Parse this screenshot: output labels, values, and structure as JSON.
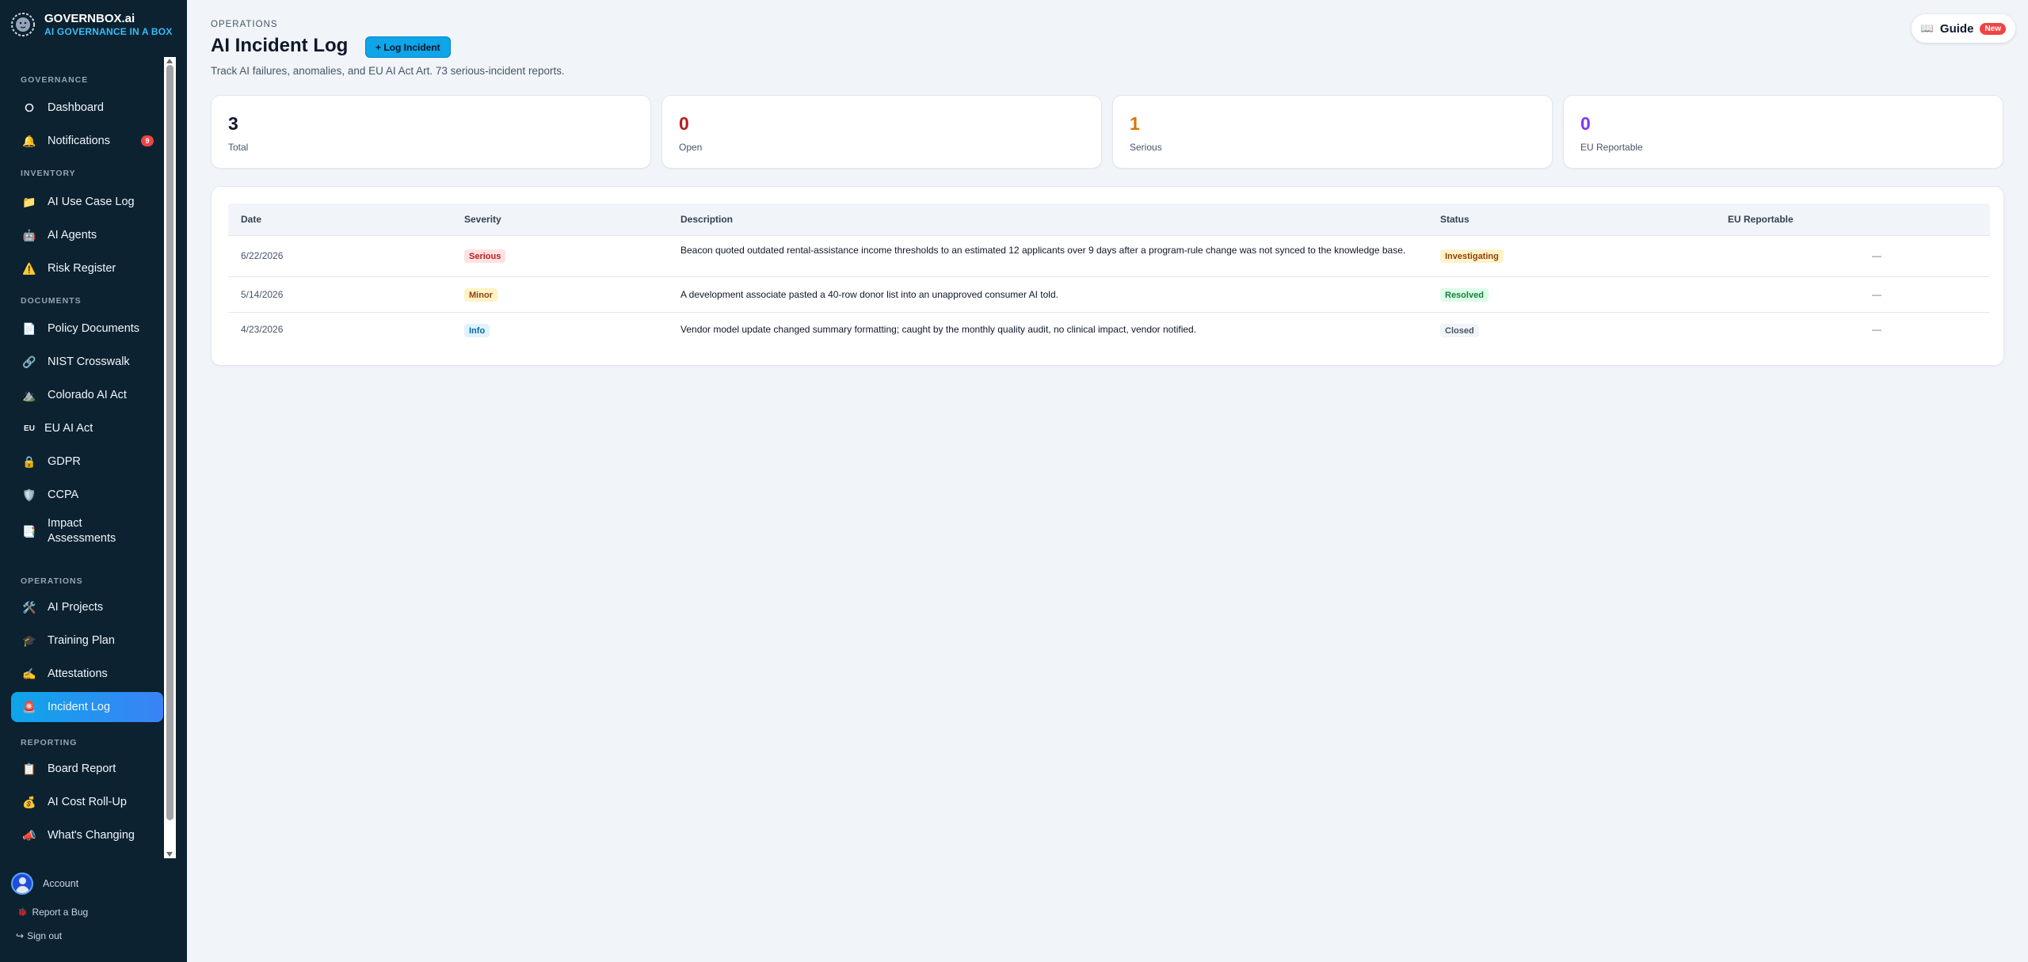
{
  "brand": {
    "name": "GOVERNBOX.ai",
    "tagline": "AI GOVERNANCE IN A BOX"
  },
  "sidebar": {
    "sections": [
      {
        "label": "GOVERNANCE",
        "items": [
          {
            "label": "Dashboard",
            "icon": "circle-icon"
          },
          {
            "label": "Notifications",
            "icon": "bell-icon",
            "badge": "9"
          }
        ]
      },
      {
        "label": "INVENTORY",
        "items": [
          {
            "label": "AI Use Case Log",
            "icon": "folder-icon"
          },
          {
            "label": "AI Agents",
            "icon": "robot-icon"
          },
          {
            "label": "Risk Register",
            "icon": "warning-icon"
          }
        ]
      },
      {
        "label": "DOCUMENTS",
        "items": [
          {
            "label": "Policy Documents",
            "icon": "document-icon"
          },
          {
            "label": "NIST Crosswalk",
            "icon": "link-icon"
          },
          {
            "label": "Colorado AI Act",
            "icon": "mountain-icon"
          },
          {
            "label": "EU AI Act",
            "icon": "eu-icon",
            "icon_text": "EU"
          },
          {
            "label": "GDPR",
            "icon": "lock-icon"
          },
          {
            "label": "CCPA",
            "icon": "shield-icon"
          },
          {
            "label": "Impact Assessments",
            "icon": "report-icon"
          }
        ]
      },
      {
        "label": "OPERATIONS",
        "items": [
          {
            "label": "AI Projects",
            "icon": "tools-icon"
          },
          {
            "label": "Training Plan",
            "icon": "graduation-cap-icon"
          },
          {
            "label": "Attestations",
            "icon": "writing-hand-icon"
          },
          {
            "label": "Incident Log",
            "icon": "siren-icon",
            "active": true
          }
        ]
      },
      {
        "label": "REPORTING",
        "items": [
          {
            "label": "Board Report",
            "icon": "clipboard-icon"
          },
          {
            "label": "AI Cost Roll-Up",
            "icon": "money-bag-icon"
          },
          {
            "label": "What's Changing",
            "icon": "megaphone-icon"
          }
        ]
      }
    ],
    "account": {
      "label": "Account"
    },
    "report_bug": {
      "label": "Report a Bug"
    },
    "sign_out": {
      "label": "Sign out",
      "icon_text": "↪"
    }
  },
  "header": {
    "eyebrow": "OPERATIONS",
    "title": "AI Incident Log",
    "log_button": "+ Log Incident",
    "subtitle": "Track AI failures, anomalies, and EU AI Act Art. 73 serious-incident reports.",
    "guide_label": "Guide",
    "guide_badge": "New",
    "guide_icon": "book-icon"
  },
  "stats": [
    {
      "value": "3",
      "label": "Total",
      "color": "#0f172a"
    },
    {
      "value": "0",
      "label": "Open",
      "color": "#b91c1c"
    },
    {
      "value": "1",
      "label": "Serious",
      "color": "#d97706"
    },
    {
      "value": "0",
      "label": "EU Reportable",
      "color": "#7c3aed"
    }
  ],
  "table": {
    "columns": [
      "Date",
      "Severity",
      "Description",
      "Status",
      "EU Reportable"
    ],
    "rows": [
      {
        "date": "6/22/2026",
        "severity": "Serious",
        "severity_bg": "#fee2e2",
        "severity_fg": "#b91c1c",
        "description": "Beacon quoted outdated rental-assistance income thresholds to an estimated 12 applicants over 9 days after a program-rule change was not synced to the knowledge base.",
        "status": "Investigating",
        "status_bg": "#fef3c7",
        "status_fg": "#92400e",
        "eu_reportable": "—"
      },
      {
        "date": "5/14/2026",
        "severity": "Minor",
        "severity_bg": "#fef3c7",
        "severity_fg": "#92400e",
        "description": "A development associate pasted a 40-row donor list into an unapproved consumer AI told.",
        "status": "Resolved",
        "status_bg": "#dcfce7",
        "status_fg": "#15803d",
        "eu_reportable": "—"
      },
      {
        "date": "4/23/2026",
        "severity": "Info",
        "severity_bg": "#e0f2fe",
        "severity_fg": "#0369a1",
        "description": "Vendor model update changed summary formatting; caught by the monthly quality audit, no clinical impact, vendor notified.",
        "status": "Closed",
        "status_bg": "#f1f5f9",
        "status_fg": "#475569",
        "eu_reportable": "—"
      }
    ]
  }
}
